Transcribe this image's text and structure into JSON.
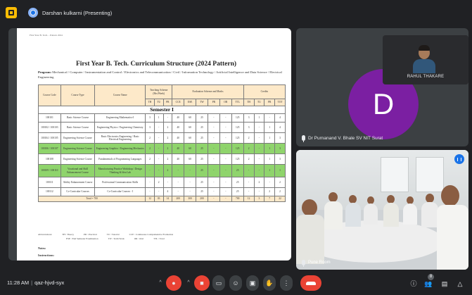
{
  "topbar": {
    "presenter_label": "Darshan kulkarni (Presenting)"
  },
  "document": {
    "header_text": "First Year B. Tech. - Pattern 2024",
    "title": "First Year B. Tech. Curriculum Structure (2024 Pattern)",
    "program_label": "Program:",
    "program_text": "Mechanical / Computer / Instrumentation and Control / Electronics and Telecommunication / Civil / Information Technology / Artificial Intelligence and Data Science / Electrical Engineering",
    "table": {
      "col_course_code": "Course Code",
      "col_course_type": "Course Type",
      "col_course_name": "Course Name",
      "col_teaching": "Teaching Scheme (Hrs/Week)",
      "col_evaluation": "Evaluation Scheme and Marks",
      "col_credits": "Credits",
      "sub_teaching": [
        "TH",
        "TU",
        "PR"
      ],
      "sub_evaluation": [
        "CCE",
        "ESE",
        "TW",
        "PR",
        "OR",
        "TTL"
      ],
      "sub_credits": [
        "TH",
        "TU",
        "PR",
        "TOT"
      ],
      "semester_label": "Semester I",
      "rows": [
        {
          "code": "100101",
          "type": "Basic Science Course",
          "name": "Engineering Mathematics-I",
          "th": "3",
          "tu": "1",
          "pr": "-",
          "cce": "40",
          "ese": "60",
          "tw": "25",
          "epr": "-",
          "or": "-",
          "ttl": "125",
          "cth": "3",
          "ctu": "1",
          "cpr": "-",
          "ctot": "4",
          "green": false,
          "size": "normal"
        },
        {
          "code": "100102 / 100103",
          "type": "Basic Science Course",
          "name": "Engineering Physics / Engineering Chemistry",
          "th": "3",
          "tu": "-",
          "pr": "2",
          "cce": "40",
          "ese": "60",
          "tw": "25",
          "epr": "-",
          "or": "-",
          "ttl": "125",
          "cth": "3",
          "ctu": "-",
          "cpr": "1",
          "ctot": "4",
          "green": false,
          "size": "tall"
        },
        {
          "code": "100104 / 100105",
          "type": "Engineering Science Course",
          "name": "Basic Electronics Engineering / Basic Electrical Engineering",
          "th": "2",
          "tu": "-",
          "pr": "2",
          "cce": "40",
          "ese": "60",
          "tw": "25",
          "epr": "-",
          "or": "-",
          "ttl": "125",
          "cth": "2",
          "ctu": "-",
          "cpr": "1",
          "ctot": "3",
          "green": false,
          "size": "tall"
        },
        {
          "code": "100106 / 100107",
          "type": "Engineering Science Course",
          "name": "Engineering Graphics / Engineering Mechanics",
          "th": "2",
          "tu": "-",
          "pr": "2",
          "cce": "40",
          "ese": "60",
          "tw": "25",
          "epr": "-",
          "or": "-",
          "ttl": "125",
          "cth": "2",
          "ctu": "-",
          "cpr": "1",
          "ctot": "3",
          "green": true,
          "size": "tall"
        },
        {
          "code": "100108",
          "type": "Engineering Science Course",
          "name": "Fundamentals of Programming Languages",
          "th": "2",
          "tu": "-",
          "pr": "2",
          "cce": "40",
          "ese": "60",
          "tw": "25",
          "epr": "-",
          "or": "-",
          "ttl": "125",
          "cth": "2",
          "ctu": "-",
          "cpr": "1",
          "ctot": "3",
          "green": false,
          "size": "tall"
        },
        {
          "code": "100109 / 100110",
          "type": "Vocational and Skill Enhancement Course",
          "name": "Manufacturing Practice Workshop / Design Thinking & Idea Lab",
          "th": "-",
          "tu": "-",
          "pr": "2",
          "cce": "-",
          "ese": "-",
          "tw": "25",
          "epr": "-",
          "or": "-",
          "ttl": "25",
          "cth": "-",
          "ctu": "-",
          "cpr": "1",
          "ctot": "1",
          "green": true,
          "size": "xtall"
        },
        {
          "code": "100111",
          "type": "Ability Enhancement Course",
          "name": "Professional Communication Skills",
          "th": "-",
          "tu": "2",
          "pr": "-",
          "cce": "-",
          "ese": "-",
          "tw": "25",
          "epr": "-",
          "or": "-",
          "ttl": "25",
          "cth": "-",
          "ctu": "2",
          "cpr": "-",
          "ctot": "2",
          "green": false,
          "size": "tall"
        },
        {
          "code": "100112",
          "type": "Co-Curricular Courses",
          "name": "Co-Curricular Courses - I",
          "th": "-",
          "tu": "-",
          "pr": "4",
          "cce": "-",
          "ese": "-",
          "tw": "25",
          "epr": "-",
          "or": "-",
          "ttl": "25",
          "cth": "-",
          "ctu": "-",
          "cpr": "2",
          "ctot": "2",
          "green": false,
          "size": "normal"
        }
      ],
      "total": {
        "label": "Total = 700",
        "th": "12",
        "tu": "03",
        "pr": "14",
        "cce": "200",
        "ese": "300",
        "tw": "200",
        "epr": "-",
        "or": "-",
        "ttl": "700",
        "cth": "12",
        "ctu": "3",
        "cpr": "7",
        "ctot": "22"
      }
    },
    "abbreviations_label": "Abbreviations:",
    "abbr_row1": [
      "TH : Theory",
      "PR : Practical",
      "TU : Tutorial",
      "CCE : Continuous Comprehensive Evaluation"
    ],
    "abbr_row2": [
      "ESE : End Semester Examination",
      "TW : Term Work",
      "OR : Oral",
      "TTL : Total"
    ],
    "notes_label": "Notes:",
    "instructions_label": "Instructions:"
  },
  "tiles": {
    "avatar_letter": "D",
    "avatar_color": "#7b1fa2",
    "participant_name": "Dr Purnanand V. Bhale SV NIT Surat",
    "self_name": "RAHUL THAKARE",
    "video_name": "Pune Room"
  },
  "bottombar": {
    "time": "11:28 AM",
    "separator": "|",
    "meeting_code": "qaz-hjvd-syx",
    "people_count": "8"
  }
}
